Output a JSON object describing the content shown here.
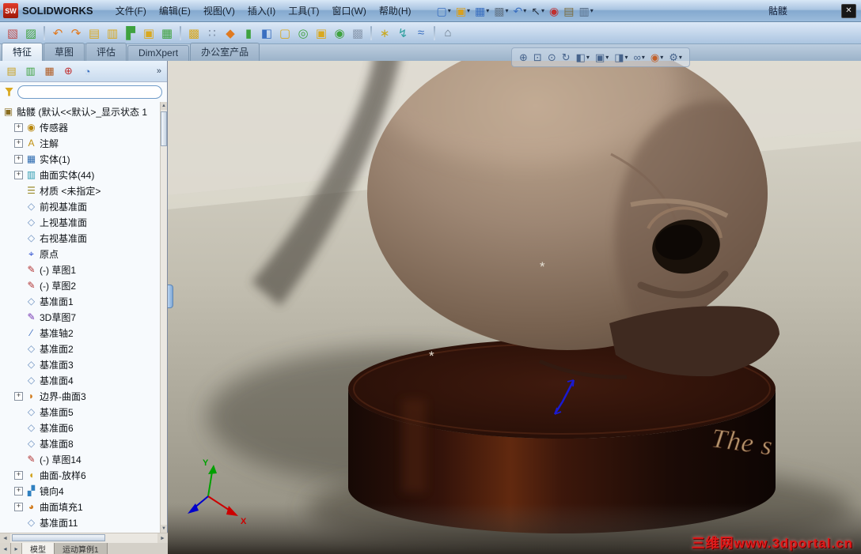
{
  "titlebar": {
    "app": "SOLIDWORKS",
    "doc_title": "骷髅",
    "menus": [
      {
        "name": "menu-file",
        "label": "文件(F)"
      },
      {
        "name": "menu-edit",
        "label": "编辑(E)"
      },
      {
        "name": "menu-view",
        "label": "视图(V)"
      },
      {
        "name": "menu-insert",
        "label": "插入(I)"
      },
      {
        "name": "menu-tools",
        "label": "工具(T)"
      },
      {
        "name": "menu-window",
        "label": "窗口(W)"
      },
      {
        "name": "menu-help",
        "label": "帮助(H)"
      }
    ],
    "tools": [
      {
        "name": "new-document-icon",
        "glyph": "▢",
        "color": "#3a6fc0",
        "caret": true
      },
      {
        "name": "open-icon",
        "glyph": "▣",
        "color": "#d8a020",
        "caret": true
      },
      {
        "name": "save-icon",
        "glyph": "▦",
        "color": "#3a6fc0",
        "caret": true
      },
      {
        "name": "print-icon",
        "glyph": "▩",
        "color": "#66788a",
        "caret": true
      },
      {
        "name": "undo-icon",
        "glyph": "↶",
        "color": "#3a6fc0",
        "caret": true
      },
      {
        "name": "select-icon",
        "glyph": "↖",
        "color": "#2a3544",
        "caret": true
      },
      {
        "name": "rebuild-icon",
        "glyph": "◉",
        "color": "#c03030",
        "caret": false
      },
      {
        "name": "file-properties-icon",
        "glyph": "▤",
        "color": "#7a6a3a",
        "caret": false
      },
      {
        "name": "panel-toggle-icon",
        "glyph": "▥",
        "color": "#556b84",
        "caret": true
      }
    ]
  },
  "toolbar2": {
    "items": [
      {
        "glyph": "▧",
        "color": "#c05050"
      },
      {
        "glyph": "▨",
        "color": "#3fa23f"
      },
      {
        "sep": true
      },
      {
        "glyph": "↶",
        "color": "#e07a20"
      },
      {
        "glyph": "↷",
        "color": "#e07a20"
      },
      {
        "glyph": "▤",
        "color": "#d9a81e"
      },
      {
        "glyph": "▥",
        "color": "#d9a81e"
      },
      {
        "glyph": "▛",
        "color": "#3fa23f"
      },
      {
        "glyph": "▣",
        "color": "#d9a81e"
      },
      {
        "glyph": "▦",
        "color": "#3fa23f"
      },
      {
        "sep": true
      },
      {
        "glyph": "▩",
        "color": "#d9a81e"
      },
      {
        "glyph": "∷",
        "color": "#7a8aa0"
      },
      {
        "glyph": "◆",
        "color": "#e07a20"
      },
      {
        "glyph": "▮",
        "color": "#3fa23f"
      },
      {
        "glyph": "◧",
        "color": "#3a6fc0"
      },
      {
        "glyph": "▢",
        "color": "#d9a81e"
      },
      {
        "glyph": "◎",
        "color": "#3fa23f"
      },
      {
        "glyph": "▣",
        "color": "#d9a81e"
      },
      {
        "glyph": "◉",
        "color": "#3fa23f"
      },
      {
        "glyph": "▩",
        "color": "#8a9ab0"
      },
      {
        "sep": true
      },
      {
        "glyph": "∗",
        "color": "#c8a820"
      },
      {
        "glyph": "↯",
        "color": "#2f9f9f"
      },
      {
        "glyph": "≈",
        "color": "#3a6fc0"
      },
      {
        "sep": true
      },
      {
        "glyph": "⌂",
        "color": "#6a7a8a"
      }
    ]
  },
  "tab_bar": {
    "tabs": [
      {
        "name": "tab-features",
        "label": "特征",
        "active": true
      },
      {
        "name": "tab-sketch",
        "label": "草图",
        "active": false
      },
      {
        "name": "tab-evaluate",
        "label": "评估",
        "active": false
      },
      {
        "name": "tab-dimxpert",
        "label": "DimXpert",
        "active": false
      },
      {
        "name": "tab-office-products",
        "label": "办公室产品",
        "active": false
      }
    ]
  },
  "panel": {
    "chevron": "»",
    "header_icons": [
      {
        "name": "featuremanager-tab-icon",
        "glyph": "▤",
        "color": "#c8a020"
      },
      {
        "name": "propertymanager-tab-icon",
        "glyph": "▥",
        "color": "#3fa23f"
      },
      {
        "name": "configurationmanager-tab-icon",
        "glyph": "▦",
        "color": "#b05a20"
      },
      {
        "name": "dimxpertmanager-tab-icon",
        "glyph": "⊕",
        "color": "#c03030"
      },
      {
        "name": "displaymanager-tab-icon",
        "glyph": "◔",
        "color": "#3a6fc0"
      }
    ],
    "filter": {
      "value": ""
    },
    "tree": {
      "root": {
        "label": "骷髅 (默认<<默认>_显示状态 1",
        "glyph": "▣"
      },
      "items": [
        {
          "label": "传感器",
          "icon": "sensors-folder-icon",
          "glyph": "◉",
          "color": "#b8860b",
          "expander": true
        },
        {
          "label": "注解",
          "icon": "annotations-folder-icon",
          "glyph": "A",
          "color": "#c09010",
          "expander": true
        },
        {
          "label": "实体(1)",
          "icon": "solid-bodies-folder-icon",
          "glyph": "▦",
          "color": "#2e6bb0",
          "expander": true
        },
        {
          "label": "曲面实体(44)",
          "icon": "surface-bodies-folder-icon",
          "glyph": "▥",
          "color": "#2e9bb0",
          "expander": true
        },
        {
          "label": "材质 <未指定>",
          "icon": "material-icon",
          "glyph": "☰",
          "color": "#9a8a2a"
        },
        {
          "label": "前视基准面",
          "icon": "plane-icon",
          "glyph": "◇",
          "color": "#6a8fbf"
        },
        {
          "label": "上视基准面",
          "icon": "plane-icon",
          "glyph": "◇",
          "color": "#6a8fbf"
        },
        {
          "label": "右视基准面",
          "icon": "plane-icon",
          "glyph": "◇",
          "color": "#6a8fbf"
        },
        {
          "label": "原点",
          "icon": "origin-icon",
          "glyph": "⌖",
          "color": "#2244cc"
        },
        {
          "label": "(-) 草图1",
          "icon": "sketch-icon",
          "glyph": "✎",
          "color": "#b03030"
        },
        {
          "label": "(-) 草图2",
          "icon": "sketch-icon",
          "glyph": "✎",
          "color": "#b03030"
        },
        {
          "label": "基准面1",
          "icon": "plane-icon",
          "glyph": "◇",
          "color": "#6a8fbf"
        },
        {
          "label": "3D草图7",
          "icon": "3d-sketch-icon",
          "glyph": "✎",
          "color": "#7030b0"
        },
        {
          "label": "基准轴2",
          "icon": "axis-icon",
          "glyph": "∕",
          "color": "#3366bb"
        },
        {
          "label": "基准面2",
          "icon": "plane-icon",
          "glyph": "◇",
          "color": "#6a8fbf"
        },
        {
          "label": "基准面3",
          "icon": "plane-icon",
          "glyph": "◇",
          "color": "#6a8fbf"
        },
        {
          "label": "基准面4",
          "icon": "plane-icon",
          "glyph": "◇",
          "color": "#6a8fbf"
        },
        {
          "label": "边界-曲面3",
          "icon": "boundary-surface-icon",
          "glyph": "◗",
          "color": "#d07818",
          "expander": true
        },
        {
          "label": "基准面5",
          "icon": "plane-icon",
          "glyph": "◇",
          "color": "#6a8fbf"
        },
        {
          "label": "基准面6",
          "icon": "plane-icon",
          "glyph": "◇",
          "color": "#6a8fbf"
        },
        {
          "label": "基准面8",
          "icon": "plane-icon",
          "glyph": "◇",
          "color": "#6a8fbf"
        },
        {
          "label": "(-) 草图14",
          "icon": "sketch-icon",
          "glyph": "✎",
          "color": "#b03030"
        },
        {
          "label": "曲面-放样6",
          "icon": "surface-loft-icon",
          "glyph": "◖",
          "color": "#d0a018",
          "expander": true
        },
        {
          "label": "镜向4",
          "icon": "mirror-icon",
          "glyph": "▞",
          "color": "#3080c0",
          "expander": true
        },
        {
          "label": "曲面填充1",
          "icon": "surface-fill-icon",
          "glyph": "◕",
          "color": "#d07818",
          "expander": true
        },
        {
          "label": "基准面11",
          "icon": "plane-icon",
          "glyph": "◇",
          "color": "#6a8fbf"
        }
      ]
    }
  },
  "hud": {
    "items": [
      {
        "name": "zoom-fit-icon",
        "glyph": "⊕"
      },
      {
        "name": "zoom-area-icon",
        "glyph": "⊡"
      },
      {
        "name": "zoom-in-out-icon",
        "glyph": "⊙"
      },
      {
        "name": "rotate-view-icon",
        "glyph": "↻"
      },
      {
        "name": "section-view-icon",
        "glyph": "◧",
        "caret": true
      },
      {
        "name": "view-orientation-icon",
        "glyph": "▣",
        "caret": true
      },
      {
        "name": "display-style-icon",
        "glyph": "◨",
        "caret": true
      },
      {
        "name": "hide-show-items-icon",
        "glyph": "∞",
        "caret": true
      },
      {
        "name": "appearances-icon",
        "glyph": "◉",
        "color": "#c2602a",
        "caret": true
      },
      {
        "name": "scene-icon",
        "glyph": "⚙",
        "caret": true
      }
    ]
  },
  "viewport": {
    "base_text": "The s",
    "marker_glyph": "*",
    "triad": {
      "x_label": "X",
      "y_label": "Y"
    },
    "watermark": "三维网www.3dportal.cn",
    "colors": {
      "skull": "#9d8673",
      "base": "#34130a",
      "background_top": "#dcd9ce",
      "background_bottom": "#8f8b7d",
      "watermark_red": "#e01818"
    }
  },
  "statusbar": {
    "nav": [
      {
        "name": "statusbar-prev-icon",
        "glyph": "◂"
      },
      {
        "name": "statusbar-next-icon",
        "glyph": "▸"
      }
    ],
    "tabs": [
      {
        "name": "model-tab",
        "label": "模型",
        "active": true
      },
      {
        "name": "motion-study-tab",
        "label": "运动算例1",
        "active": false
      }
    ]
  }
}
